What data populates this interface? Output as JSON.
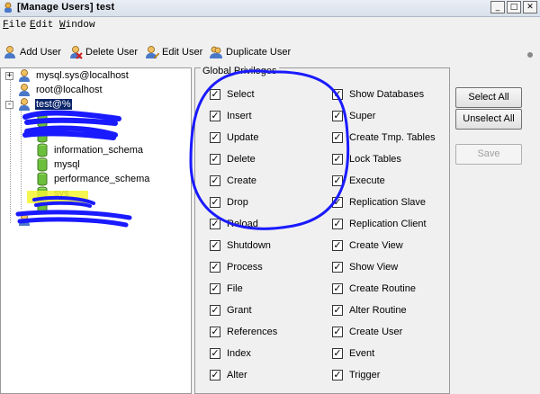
{
  "window": {
    "title": "[Manage Users] test",
    "buttons": [
      "_",
      "□",
      "✕"
    ]
  },
  "menubar": {
    "items": [
      {
        "underline": "F",
        "rest": "ile"
      },
      {
        "underline": "E",
        "rest": "dit"
      },
      {
        "underline": "W",
        "rest": "indow"
      }
    ]
  },
  "toolbar": {
    "add_user": "Add User",
    "delete_user": "Delete User",
    "edit_user": "Edit User",
    "duplicate_user": "Duplicate User"
  },
  "tree": {
    "users": [
      {
        "label": "mysql.sys@localhost"
      },
      {
        "label": "root@localhost"
      },
      {
        "label": "test@%"
      }
    ],
    "databases": [
      {
        "label": "information_schema"
      },
      {
        "label": "mysql"
      },
      {
        "label": "performance_schema"
      },
      {
        "label": "sys"
      }
    ]
  },
  "privileges": {
    "group_title": "Global Privileges",
    "left": [
      "Select",
      "Insert",
      "Update",
      "Delete",
      "Create",
      "Drop",
      "Reload",
      "Shutdown",
      "Process",
      "File",
      "Grant",
      "References",
      "Index",
      "Alter"
    ],
    "right": [
      "Show Databases",
      "Super",
      "Create Tmp. Tables",
      "Lock Tables",
      "Execute",
      "Replication Slave",
      "Replication Client",
      "Create View",
      "Show View",
      "Create Routine",
      "Alter Routine",
      "Create User",
      "Event",
      "Trigger"
    ],
    "check_mark": "✓"
  },
  "buttons": {
    "select_all": "Select All",
    "unselect_all": "Unselect All",
    "save": "Save"
  },
  "colors": {
    "annotation_blue": "#1a1aff",
    "highlight_yellow": "#f5f532",
    "selection_navy": "#0a246a"
  }
}
